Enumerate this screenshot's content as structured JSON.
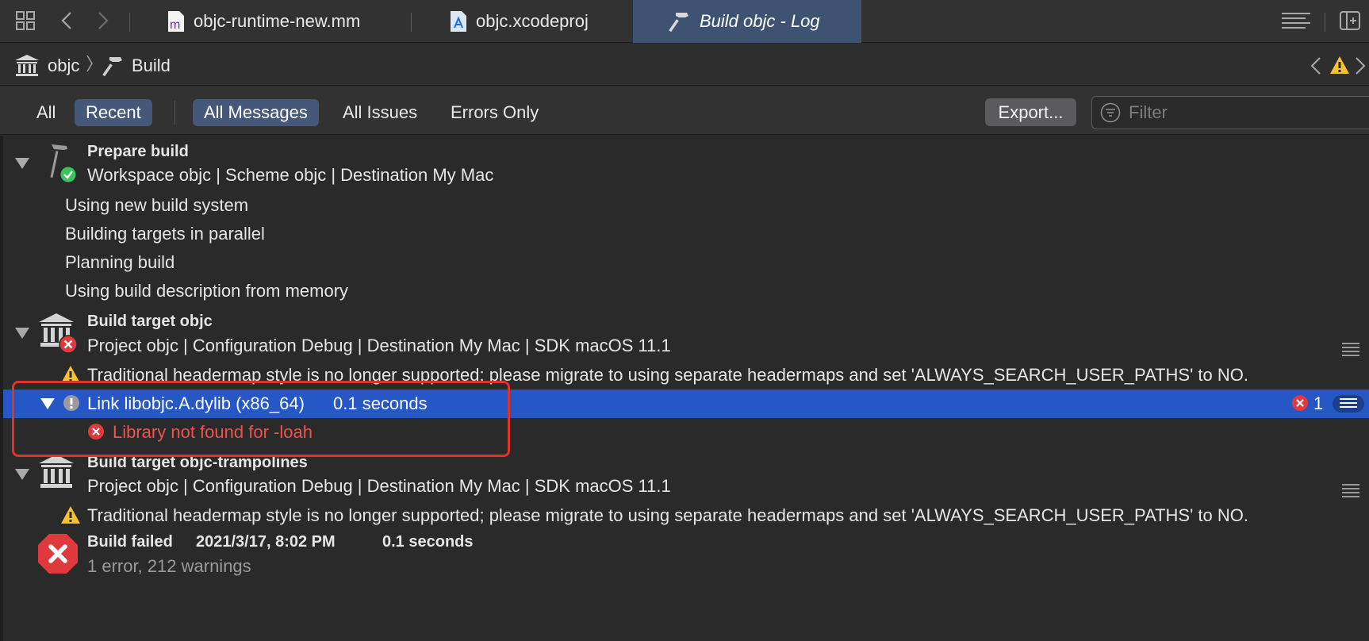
{
  "tabs": [
    {
      "label": "objc-runtime-new.mm",
      "icon": "objcpp-file-icon"
    },
    {
      "label": "objc.xcodeproj",
      "icon": "xcodeproj-icon"
    },
    {
      "label": "Build objc - Log",
      "icon": "hammer-icon"
    }
  ],
  "path": {
    "project": "objc",
    "item": "Build"
  },
  "filters": {
    "scope": [
      "All",
      "Recent"
    ],
    "scope_selected": "Recent",
    "messages": [
      "All Messages",
      "All Issues",
      "Errors Only"
    ],
    "messages_selected": "All Messages",
    "export_label": "Export...",
    "search_placeholder": "Filter"
  },
  "log": {
    "prepare": {
      "title": "Prepare build",
      "subtitle": "Workspace objc | Scheme objc | Destination My Mac",
      "lines": [
        "Using new build system",
        "Building targets in parallel",
        "Planning build",
        "Using build description from memory"
      ]
    },
    "target1": {
      "title": "Build target objc",
      "subtitle": "Project objc | Configuration Debug | Destination My Mac | SDK macOS 11.1",
      "warning": "Traditional headermap style is no longer supported; please migrate to using separate headermaps and set 'ALWAYS_SEARCH_USER_PATHS' to NO."
    },
    "link": {
      "label": "Link libobjc.A.dylib (x86_64)",
      "duration": "0.1 seconds",
      "error_count": "1",
      "error": "Library not found for -loah"
    },
    "target2": {
      "title": "Build target objc-trampolines",
      "subtitle": "Project objc | Configuration Debug | Destination My Mac | SDK macOS 11.1",
      "warning": "Traditional headermap style is no longer supported; please migrate to using separate headermaps and set 'ALWAYS_SEARCH_USER_PATHS' to NO."
    },
    "result": {
      "status": "Build failed",
      "timestamp": "2021/3/17, 8:02 PM",
      "duration": "0.1 seconds",
      "summary": "1 error, 212 warnings"
    }
  },
  "colors": {
    "accent": "#2557c7",
    "error": "#e0393e",
    "warning": "#f5c12e",
    "success": "#34c759"
  }
}
